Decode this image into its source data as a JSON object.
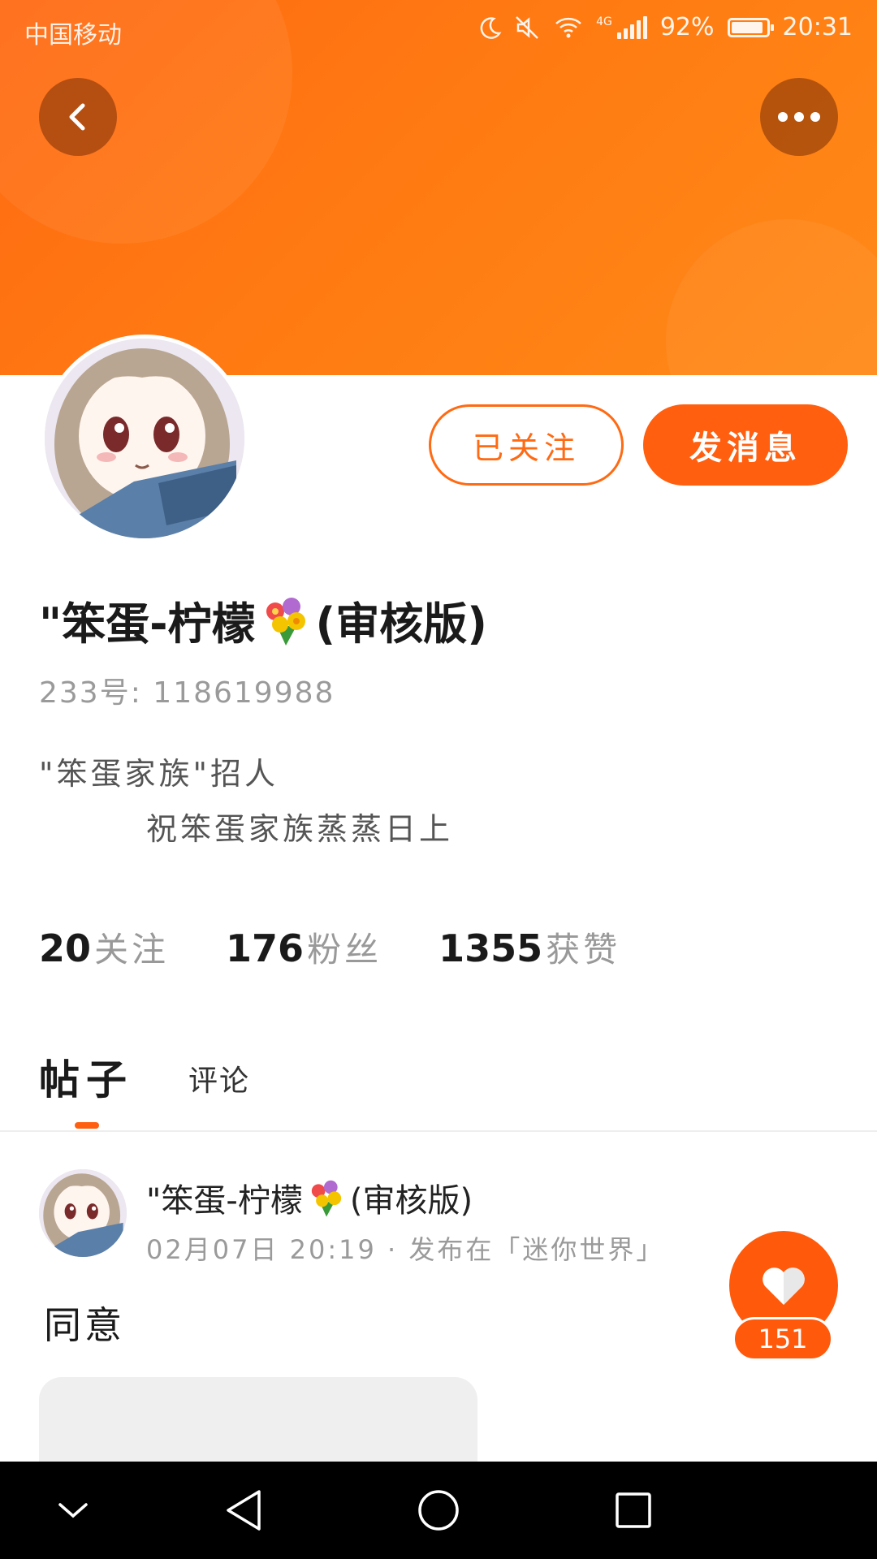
{
  "status_bar": {
    "carrier": "中国移动",
    "network": "4G",
    "battery": "92%",
    "time": "20:31"
  },
  "profile": {
    "username_prefix": "\"笨蛋-柠檬",
    "username_suffix": "(审核版)",
    "user_id": "233号: 118619988",
    "bio_line1": "\"笨蛋家族\"招人",
    "bio_line2": "祝笨蛋家族蒸蒸日上",
    "follow_button": "已关注",
    "message_button": "发消息"
  },
  "stats": [
    {
      "value": "20",
      "label": "关注"
    },
    {
      "value": "176",
      "label": "粉丝"
    },
    {
      "value": "1355",
      "label": "获赞"
    }
  ],
  "tabs": {
    "posts": "帖子",
    "comments": "评论"
  },
  "post": {
    "author_prefix": "\"笨蛋-柠檬",
    "author_suffix": "(审核版)",
    "meta": "02月07日 20:19 · 发布在「迷你世界」",
    "text": "同意"
  },
  "like": {
    "count": "151"
  },
  "colors": {
    "accent": "#ff5f0f",
    "banner_start": "#ff6a13",
    "banner_end": "#ff8a18"
  },
  "icons": [
    "back-arrow-icon",
    "more-dots-icon",
    "heart-icon",
    "moon-icon",
    "mute-icon",
    "wifi-icon",
    "signal-icon",
    "battery-icon",
    "flower-bouquet-icon",
    "nav-back-icon",
    "nav-home-icon",
    "nav-recents-icon",
    "nav-collapse-icon"
  ]
}
